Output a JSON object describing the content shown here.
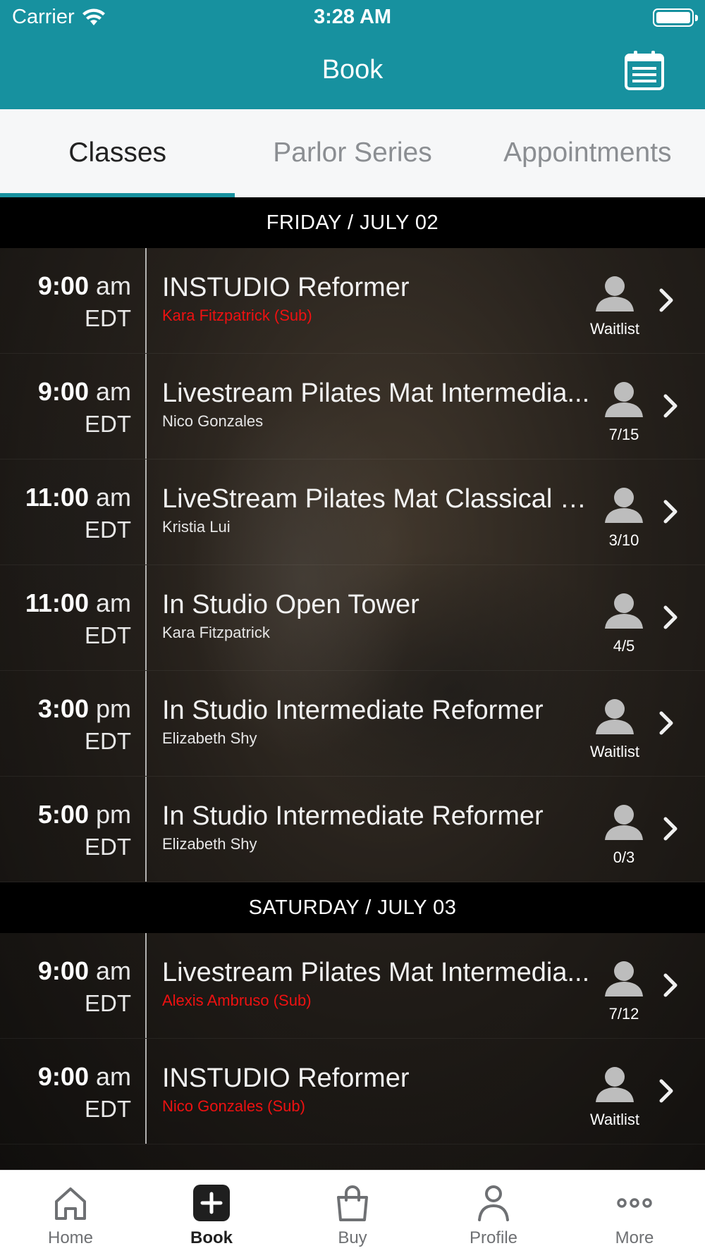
{
  "status": {
    "carrier": "Carrier",
    "time": "3:28 AM"
  },
  "nav": {
    "title": "Book"
  },
  "tabs": [
    {
      "label": "Classes",
      "active": true
    },
    {
      "label": "Parlor Series",
      "active": false
    },
    {
      "label": "Appointments",
      "active": false
    }
  ],
  "days": [
    {
      "header": "FRIDAY / JULY 02",
      "classes": [
        {
          "time": "9:00",
          "period": "am",
          "tz": "EDT",
          "name": "INSTUDIO Reformer",
          "instructor": "Kara Fitzpatrick (Sub)",
          "sub": true,
          "capacity": "Waitlist"
        },
        {
          "time": "9:00",
          "period": "am",
          "tz": "EDT",
          "name": "Livestream Pilates Mat Intermedia...",
          "instructor": "Nico Gonzales",
          "sub": false,
          "capacity": "7/15"
        },
        {
          "time": "11:00",
          "period": "am",
          "tz": "EDT",
          "name": "LiveStream Pilates Mat Classical Fl...",
          "instructor": "Kristia Lui",
          "sub": false,
          "capacity": "3/10"
        },
        {
          "time": "11:00",
          "period": "am",
          "tz": "EDT",
          "name": "In Studio Open Tower",
          "instructor": "Kara Fitzpatrick",
          "sub": false,
          "capacity": "4/5"
        },
        {
          "time": "3:00",
          "period": "pm",
          "tz": "EDT",
          "name": "In Studio Intermediate Reformer",
          "instructor": "Elizabeth Shy",
          "sub": false,
          "capacity": "Waitlist"
        },
        {
          "time": "5:00",
          "period": "pm",
          "tz": "EDT",
          "name": "In Studio Intermediate Reformer",
          "instructor": "Elizabeth Shy",
          "sub": false,
          "capacity": "0/3"
        }
      ]
    },
    {
      "header": "SATURDAY / JULY 03",
      "classes": [
        {
          "time": "9:00",
          "period": "am",
          "tz": "EDT",
          "name": "Livestream Pilates Mat Intermedia...",
          "instructor": "Alexis Ambruso (Sub)",
          "sub": true,
          "capacity": "7/12"
        },
        {
          "time": "9:00",
          "period": "am",
          "tz": "EDT",
          "name": "INSTUDIO Reformer",
          "instructor": "Nico Gonzales (Sub)",
          "sub": true,
          "capacity": "Waitlist"
        }
      ]
    }
  ],
  "tabbar": [
    {
      "label": "Home",
      "icon": "home-icon",
      "active": false
    },
    {
      "label": "Book",
      "icon": "plus-square-icon",
      "active": true
    },
    {
      "label": "Buy",
      "icon": "shopping-bag-icon",
      "active": false
    },
    {
      "label": "Profile",
      "icon": "person-icon",
      "active": false
    },
    {
      "label": "More",
      "icon": "more-dots-icon",
      "active": false
    }
  ],
  "colors": {
    "brand": "#17919f",
    "sub_instructor": "#ee1111"
  }
}
